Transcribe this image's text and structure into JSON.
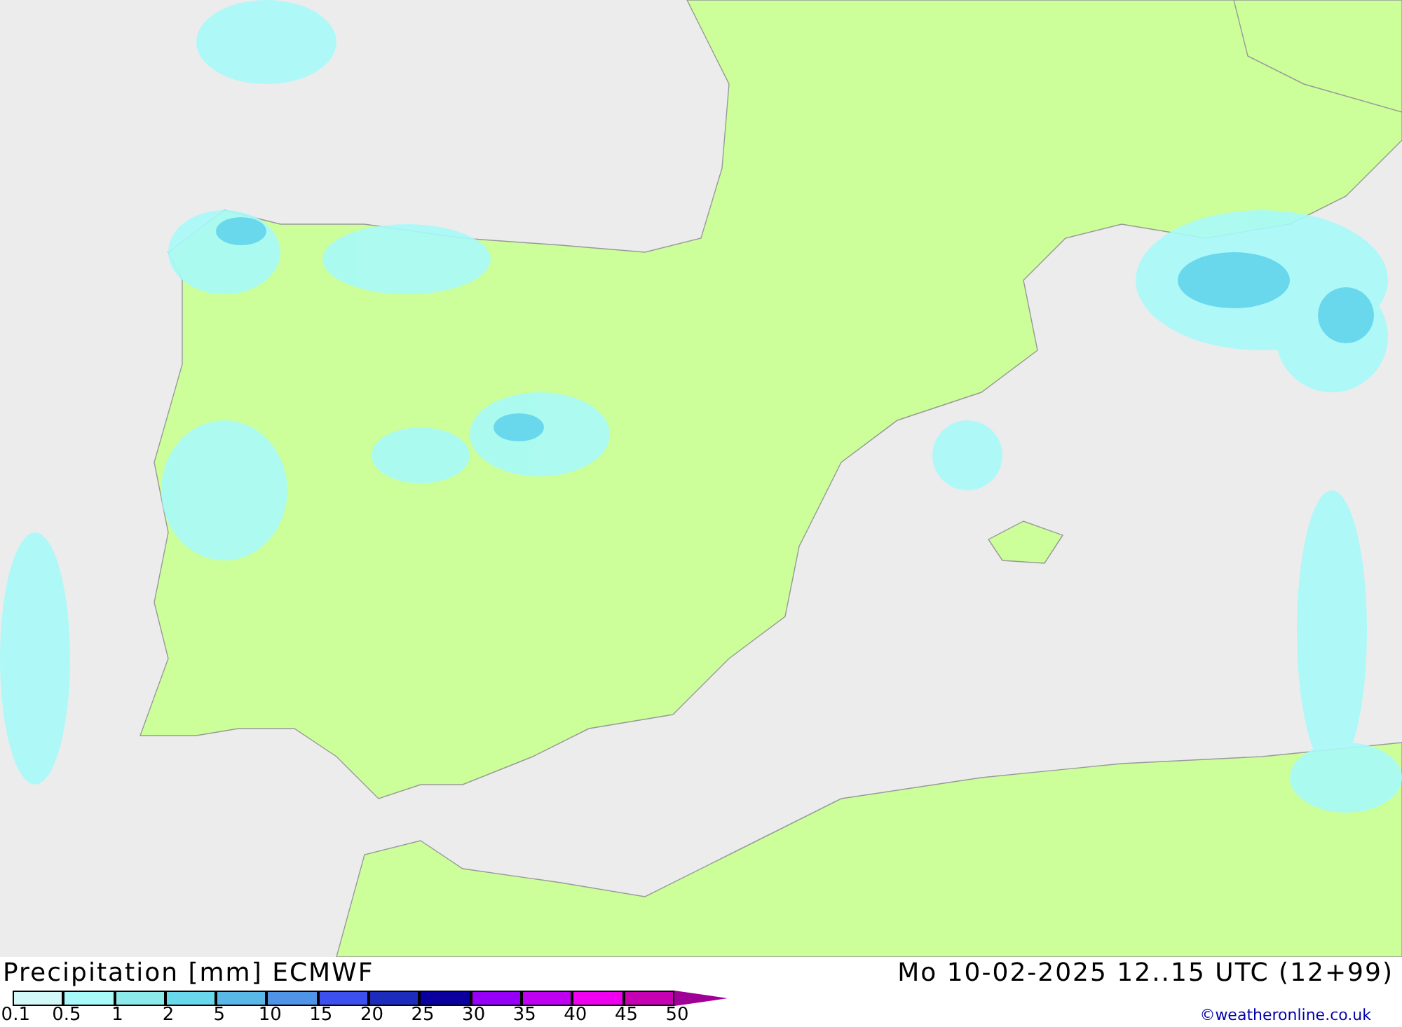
{
  "title": "Precipitation [mm] ECMWF",
  "valid_time": "Mo 10-02-2025 12..15 UTC (12+99)",
  "legend": {
    "scale": [
      {
        "kind": "swatch",
        "color": "#d2f8f8"
      },
      {
        "kind": "swatch",
        "color": "#a8fafa"
      },
      {
        "kind": "swatch",
        "color": "#8ceaea"
      },
      {
        "kind": "swatch",
        "color": "#6ad8ec"
      },
      {
        "kind": "swatch",
        "color": "#5ab8e8"
      },
      {
        "kind": "swatch",
        "color": "#5094e8"
      },
      {
        "kind": "swatch",
        "color": "#3c50f0"
      },
      {
        "kind": "swatch",
        "color": "#1c2cbc"
      },
      {
        "kind": "swatch",
        "color": "#0a00a0"
      },
      {
        "kind": "swatch",
        "color": "#9600f8"
      },
      {
        "kind": "swatch",
        "color": "#c000f0"
      },
      {
        "kind": "swatch",
        "color": "#f000f0"
      },
      {
        "kind": "swatch",
        "color": "#c800b4"
      },
      {
        "kind": "arrow",
        "color": "#a00096"
      }
    ],
    "ticks": [
      "0.1",
      "0.5",
      "1",
      "2",
      "5",
      "10",
      "15",
      "20",
      "25",
      "30",
      "35",
      "40",
      "45",
      "50"
    ]
  },
  "credit": "©weatheronline.co.uk"
}
